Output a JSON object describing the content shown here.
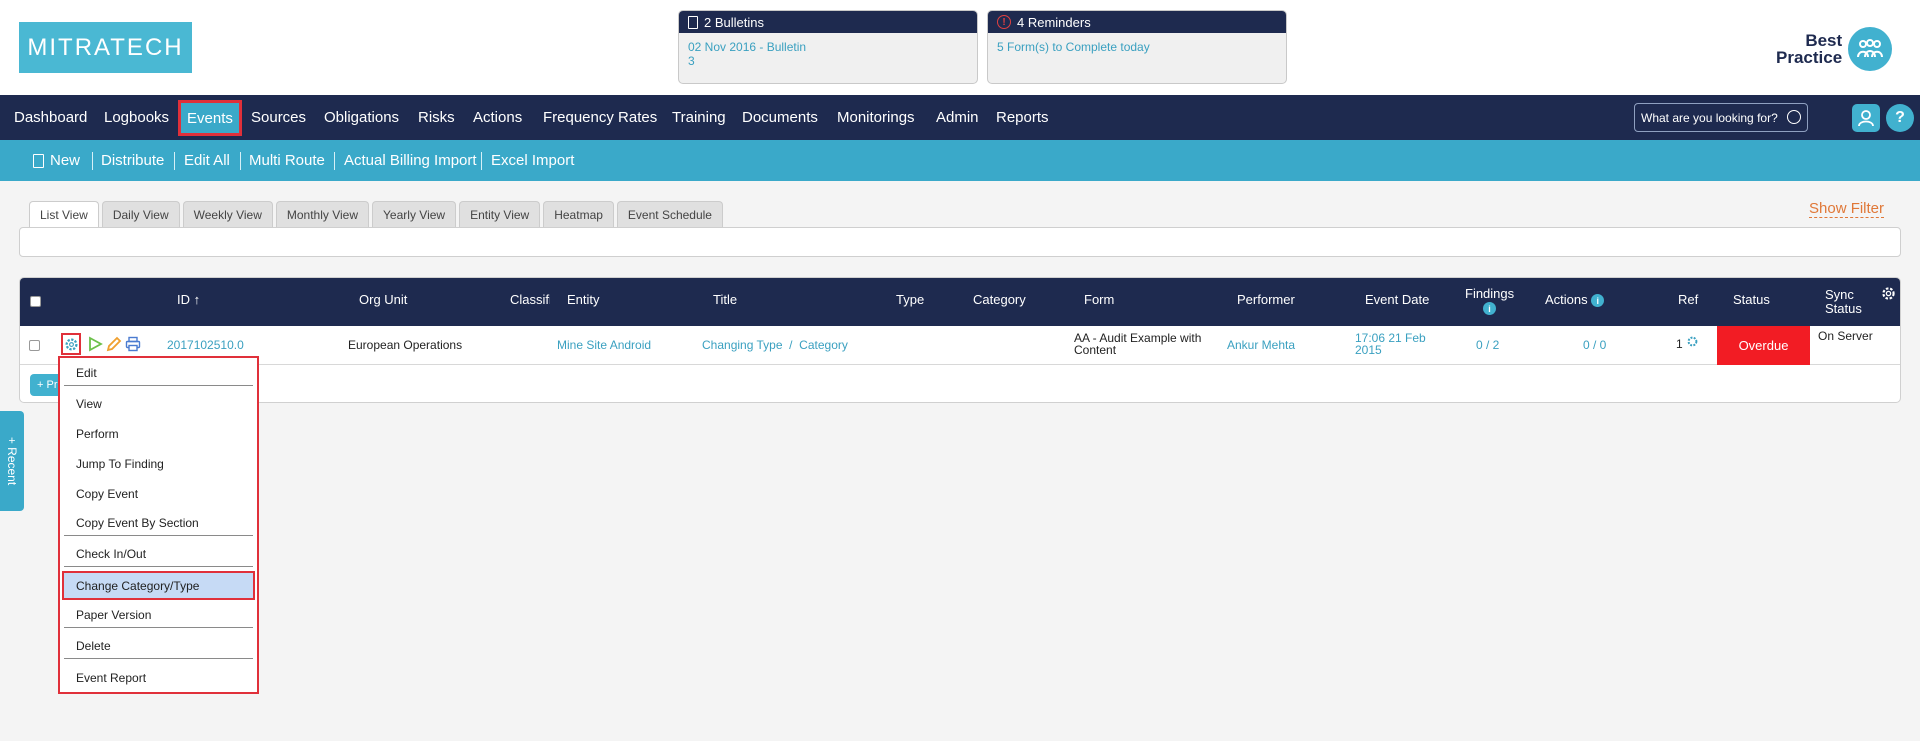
{
  "brand": {
    "logo_text": "MITRATECH",
    "badge_line1": "Best",
    "badge_line2": "Practice"
  },
  "bulletins": {
    "title": "2 Bulletins",
    "line1": "02 Nov 2016 - Bulletin",
    "line2": "3"
  },
  "reminders": {
    "title": "4 Reminders",
    "line1": "5 Form(s) to Complete today"
  },
  "nav": {
    "items": [
      "Dashboard",
      "Logbooks",
      "Events",
      "Sources",
      "Obligations",
      "Risks",
      "Actions",
      "Frequency Rates",
      "Training",
      "Documents",
      "Monitorings",
      "Admin",
      "Reports"
    ],
    "active": "Events",
    "search_placeholder": "What are you looking for?",
    "help": "?"
  },
  "subnav": {
    "items": [
      "New",
      "Distribute",
      "Edit All",
      "Multi Route",
      "Actual Billing Import",
      "Excel Import"
    ]
  },
  "tabs": [
    "List View",
    "Daily View",
    "Weekly View",
    "Monthly View",
    "Yearly View",
    "Entity View",
    "Heatmap",
    "Event Schedule"
  ],
  "show_filter": "Show Filter",
  "table": {
    "columns": {
      "id": "ID ↑",
      "org_unit": "Org Unit",
      "classification": "Classifi",
      "entity": "Entity",
      "title": "Title",
      "type": "Type",
      "category": "Category",
      "form": "Form",
      "performer": "Performer",
      "event_date": "Event Date",
      "findings": "Findings",
      "actions": "Actions",
      "ref": "Ref",
      "status": "Status",
      "sync_1": "Sync",
      "sync_2": "Status"
    },
    "row": {
      "id": "2017102510.0",
      "org_unit": "European Operations",
      "entity": "Mine Site Android",
      "title": "Changing Type  /  Category",
      "form_1": "AA - Audit Example with",
      "form_2": "Content",
      "performer": "Ankur Mehta",
      "date_1": "17:06 21 Feb",
      "date_2": "2015",
      "findings": "0 / 2",
      "actions": "0 / 0",
      "ref": "1",
      "status": "Overdue",
      "sync": "On Server"
    },
    "add_label": "+ Pr"
  },
  "context_menu": {
    "items": [
      "Edit",
      "View",
      "Perform",
      "Jump To Finding",
      "Copy Event",
      "Copy Event By Section",
      "Check In/Out",
      "Change Category/Type",
      "Paper Version",
      "Delete",
      "Event Report"
    ],
    "highlighted": "Change Category/Type"
  },
  "recent_tab": "+ Recent",
  "colors": {
    "navy": "#1e2a4f",
    "teal": "#3aa9c9",
    "overdue": "#f21c24",
    "highlight_border": "#e0303a"
  }
}
